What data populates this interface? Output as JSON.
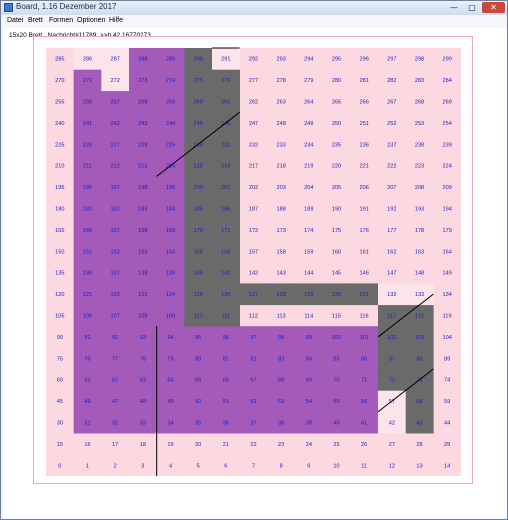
{
  "window": {
    "title": "Board, 1.16 Dezember 2017",
    "minimize_symbol": "—",
    "maximize_symbol": "□",
    "close_symbol": "✕",
    "icon": "app-window-icon"
  },
  "menu": {
    "items": [
      {
        "label": "Datei"
      },
      {
        "label": "Brett"
      },
      {
        "label": "Formen"
      },
      {
        "label": "Optionen"
      },
      {
        "label": "Hilfe"
      }
    ]
  },
  "info": {
    "text": "15x20 Brett , Nachricht#11789: >>b 42 16770273"
  },
  "board": {
    "columns": 15,
    "rows": 20,
    "numbering": "row 0 at bottom, cell number = row * 15 + column",
    "colors": {
      "background": "#fcd9e0",
      "purple": "#a35ab8",
      "gray": "#6a6a6a",
      "highlight_pink": "#fde4ea",
      "number_blue": "#2020c0",
      "line": "#000000"
    },
    "purple_cells": [
      31,
      32,
      33,
      34,
      35,
      36,
      37,
      38,
      39,
      40,
      41,
      42,
      46,
      47,
      48,
      49,
      50,
      51,
      52,
      53,
      54,
      55,
      56,
      57,
      61,
      62,
      63,
      64,
      65,
      66,
      67,
      68,
      69,
      70,
      71,
      72,
      76,
      77,
      78,
      79,
      80,
      81,
      82,
      83,
      84,
      85,
      86,
      87,
      91,
      92,
      93,
      94,
      95,
      96,
      97,
      98,
      99,
      100,
      101,
      102,
      106,
      107,
      108,
      109,
      121,
      122,
      123,
      124,
      136,
      137,
      138,
      139,
      151,
      152,
      153,
      154,
      166,
      167,
      168,
      169,
      181,
      182,
      183,
      184,
      196,
      197,
      198,
      199,
      211,
      212,
      213,
      214,
      226,
      227,
      228,
      229,
      241,
      242,
      243,
      244,
      256,
      257,
      258,
      259,
      271,
      272,
      273,
      274,
      286,
      287,
      288,
      289
    ],
    "gray_cells": [
      43,
      58,
      72,
      73,
      87,
      88,
      102,
      103,
      117,
      118,
      110,
      111,
      125,
      126,
      127,
      128,
      129,
      130,
      131,
      132,
      133,
      140,
      155,
      170,
      185,
      200,
      215,
      230,
      245,
      260,
      275,
      290,
      110,
      111,
      125,
      126,
      140,
      141,
      155,
      156,
      170,
      171,
      185,
      186,
      200,
      201,
      215,
      216,
      230,
      231,
      245,
      246,
      260,
      261,
      275,
      276,
      290,
      291
    ],
    "light_cells": [
      42,
      57,
      132,
      133,
      272,
      286,
      287,
      291
    ],
    "dark_lines": [
      {
        "from": [
          4,
          0.0
        ],
        "to": [
          4,
          7.0
        ]
      },
      {
        "from": [
          4,
          14.0
        ],
        "to": [
          7,
          17.0
        ]
      },
      {
        "from": [
          6,
          20.0
        ],
        "to": [
          7,
          20.0
        ]
      },
      {
        "from": [
          12,
          6.5
        ],
        "to": [
          14,
          8.5
        ]
      },
      {
        "from": [
          12,
          3.0
        ],
        "to": [
          14,
          5.0
        ]
      }
    ]
  }
}
